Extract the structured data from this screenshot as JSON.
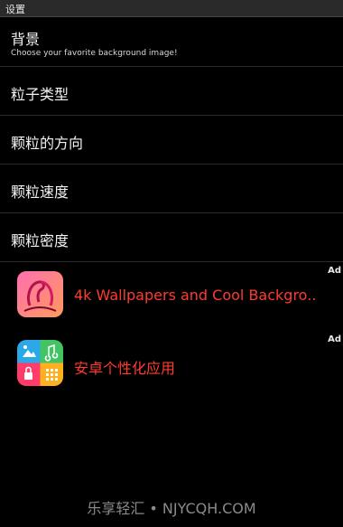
{
  "window": {
    "title": "设置"
  },
  "settings": [
    {
      "label": "背景",
      "subtitle": "Choose your favorite background image!"
    },
    {
      "label": "粒子类型"
    },
    {
      "label": "颗粒的方向"
    },
    {
      "label": "颗粒速度"
    },
    {
      "label": "颗粒密度"
    }
  ],
  "ads": [
    {
      "badge": "Ad",
      "title": "4k Wallpapers and Cool Backgro..",
      "icon": "flamingo-wallpaper-icon"
    },
    {
      "badge": "Ad",
      "title": "安卓个性化应用",
      "icon": "app-grid-icon"
    }
  ],
  "watermark": {
    "text": "乐享轻汇 • NJYCQH.COM"
  }
}
